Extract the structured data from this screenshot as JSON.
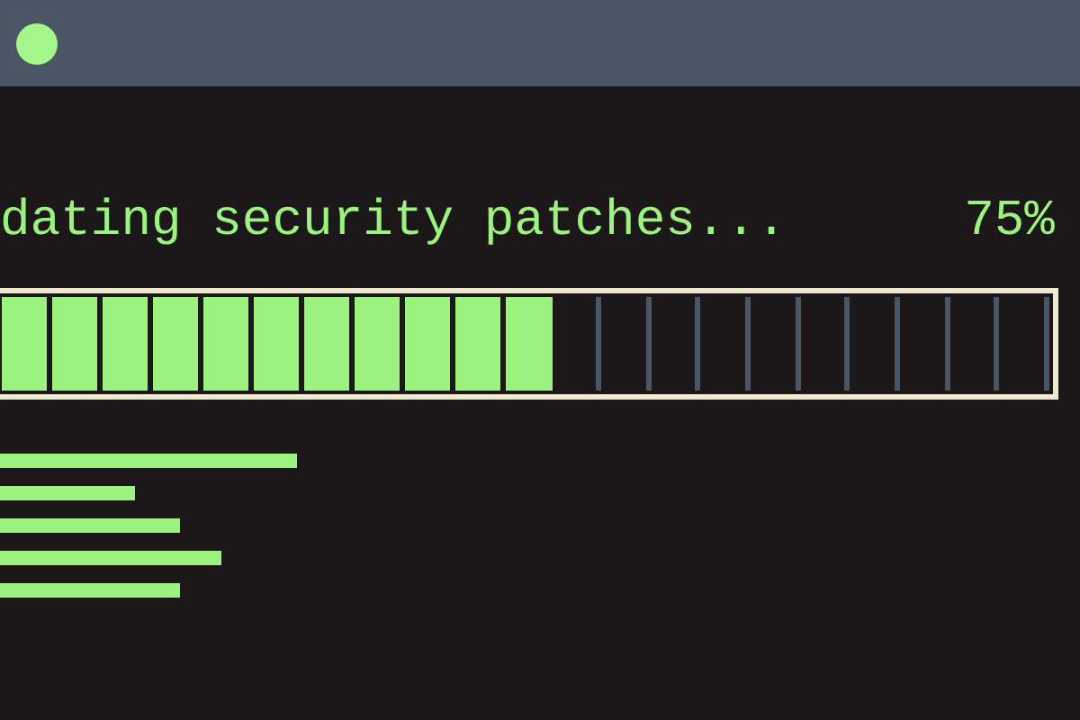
{
  "status": {
    "message": "dating security patches...",
    "percent": "75%"
  },
  "progress": {
    "level": 0.53
  }
}
